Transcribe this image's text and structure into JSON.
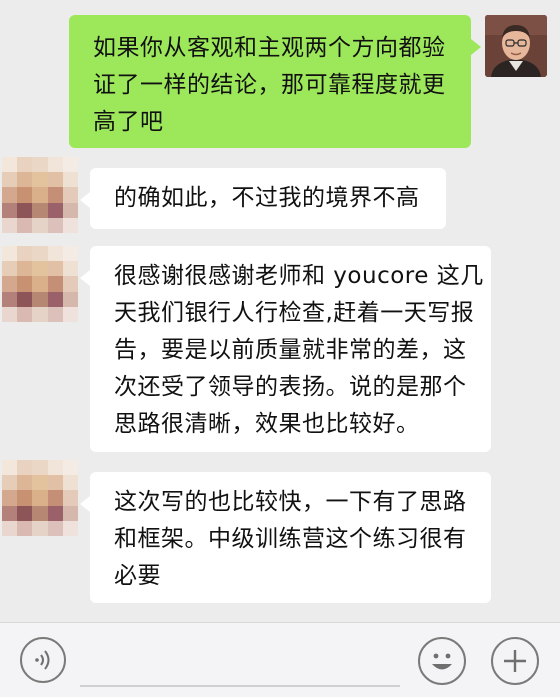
{
  "messages": [
    {
      "side": "right",
      "lines": [
        "如果你从客观和主观两个方向都验",
        "证了一样的结论，那可靠程度就更",
        "高了吧"
      ]
    },
    {
      "side": "left",
      "lines": [
        "的确如此，不过我的境界不高"
      ]
    },
    {
      "side": "left",
      "lines": [
        "很感谢很感谢老师和 youcore 这几",
        "天我们银行人行检查,赶着一天写报",
        "告，要是以前质量就非常的差，这",
        "次还受了领导的表扬。说的是那个",
        "思路很清晰，效果也比较好。"
      ]
    },
    {
      "side": "left",
      "lines": [
        "这次写的也比较快，一下有了思路",
        "和框架。中级训练营这个练习很有",
        "必要"
      ]
    }
  ],
  "colors": {
    "chat_background": "#ececec",
    "outgoing_bubble": "#9de85a",
    "incoming_bubble": "#ffffff",
    "input_bar": "#f4f4f6"
  },
  "icons": {
    "voice": "voice-icon",
    "emoji": "emoji-icon",
    "plus": "plus-icon"
  }
}
